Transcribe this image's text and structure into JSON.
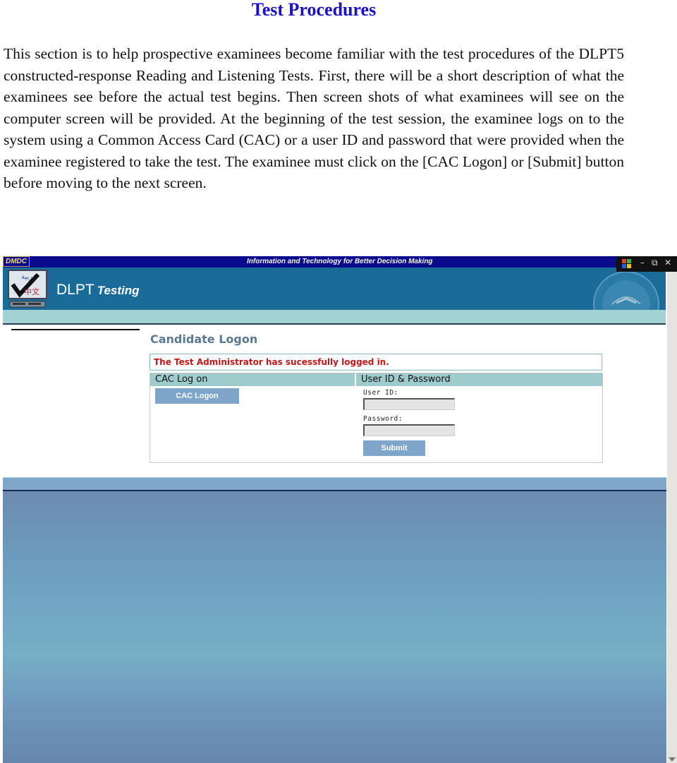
{
  "document": {
    "title": "Test Procedures",
    "paragraph": "This section is to help prospective examinees become familiar with the test procedures of the DLPT5 constructed-response Reading and Listening Tests. First, there will be a short description of what the examinees see before the actual test begins. Then screen shots of what examinees will see on the computer screen will be provided. At the beginning of the test session, the examinee logs on to the system using a Common Access Card (CAC) or a user ID and password that were provided when the examinee registered to take the test. The examinee must click on the [CAC Logon] or [Submit] button before moving to the next screen."
  },
  "screenshot": {
    "topbar": {
      "org": "DMDC",
      "tagline": "Information and Technology for Better Decision Making"
    },
    "window_controls": {
      "minimize": "–",
      "restore": "⧉",
      "close": "✕"
    },
    "header": {
      "title_main": "DLPT",
      "title_sub": "Testing",
      "logo_glyphs": "عربية 中文"
    },
    "logon": {
      "title": "Candidate Logon",
      "message": "The Test Administrator has sucessfully logged in.",
      "cac_panel": {
        "header": "CAC Log on",
        "button": "CAC Logon"
      },
      "userpass_panel": {
        "header": "User ID & Password",
        "user_id_label": "User ID:",
        "user_id_value": "",
        "password_label": "Password:",
        "password_value": "",
        "submit": "Submit"
      }
    },
    "colors": {
      "header_blue": "#1b6b99",
      "topbar_navy": "#0a0a8c",
      "message_red": "#c01818",
      "panel_header": "#9ecccc",
      "button_blue": "#7ea6ca"
    }
  }
}
